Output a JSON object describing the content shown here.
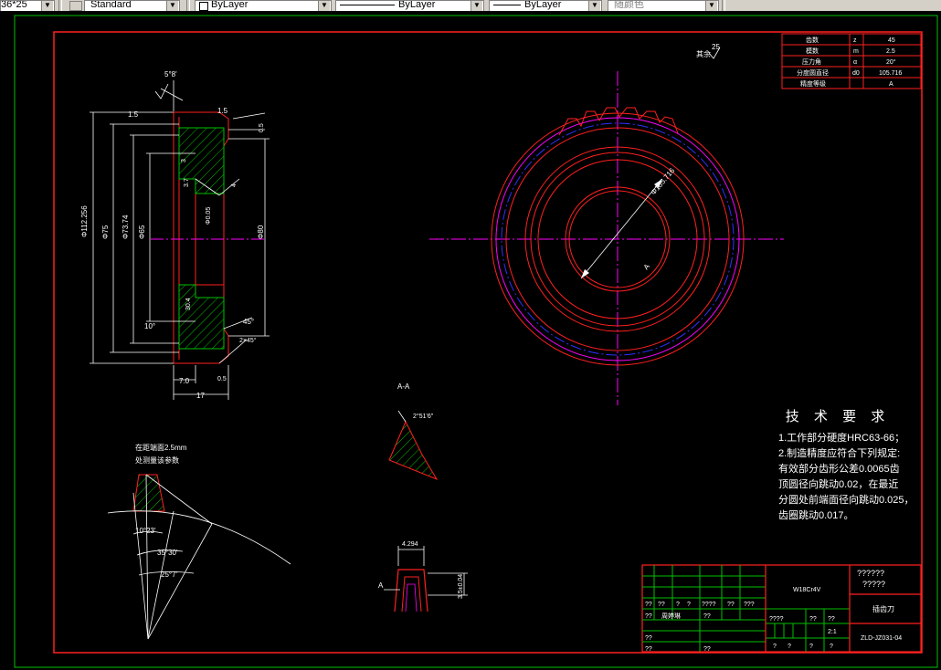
{
  "toolbar": {
    "scale_value": "36*25",
    "text_style": "Standard",
    "layer": "ByLayer",
    "linetype": "ByLayer",
    "lineweight": "ByLayer",
    "color": "随颜色"
  },
  "colors": {
    "border_red": "#ff2020",
    "frame_green": "#00c000",
    "center_magenta": "#ff00ff",
    "pitch_blue": "#3030ff",
    "hatch_green": "#00c000",
    "text_white": "#ffffff"
  },
  "param_table": {
    "rows": [
      {
        "name": "齿数",
        "sym": "z",
        "value": "45"
      },
      {
        "name": "模数",
        "sym": "m",
        "value": "2.5"
      },
      {
        "name": "压力角",
        "sym": "α",
        "value": "20°"
      },
      {
        "name": "分度圆直径",
        "sym": "d0",
        "value": "105.716"
      },
      {
        "name": "精度等级",
        "sym": "",
        "value": "A"
      }
    ]
  },
  "roughness_note": "其余",
  "roughness_value": "25",
  "section_label": "A-A",
  "section_angle": "2°51'6\"",
  "profile_note_1": "在距端面2.5mm",
  "profile_note_2": "处测量该参数",
  "profile_angles": {
    "a": "10°23'",
    "b": "35°30'",
    "c": "25°7'"
  },
  "tooth_dims": {
    "top_width": "4.294",
    "side": "3.5±0.04",
    "mark": "A"
  },
  "front_dims": {
    "top_angle": "5°8'",
    "chamfer_a": "1.5",
    "chamfer_b": "1.5",
    "side_right": "0.5",
    "d_outer": "Φ112.256",
    "d_seat": "Φ75",
    "d_mid": "Φ73.74",
    "d_bore": "Φ65",
    "d_right": "Φ80",
    "width_17": "17",
    "width_7": "7.0",
    "d_3": "3",
    "d_37": "3.7",
    "d_4": "4",
    "r_05": "0.5",
    "d_30": "30.4",
    "angle_10": "10°",
    "angle_45": "45°",
    "angle_25": "2×45°",
    "bore_tol": "Φ0.05"
  },
  "circle_dims": {
    "diameter": "Φ105.716",
    "mark": "A"
  },
  "tech_notes": {
    "title": "技 术 要 求",
    "lines": [
      "1.工作部分硬度HRC63-66；",
      "2.制造精度应符合下列规定:",
      "有效部分齿形公差0.0065齿",
      "顶圆径向跳动0.02，在最近",
      "分圆处前端面径向跳动0.025，",
      "齿圈跳动0.017。"
    ]
  },
  "title_block": {
    "material": "W18Cr4V",
    "title": "插齿刀",
    "code_top": "??????",
    "code_top2": "?????",
    "drawing_no": "ZLD-JZ031-04",
    "scale": "2:1",
    "row_labels": [
      "??",
      "??",
      "?",
      "?",
      "????",
      "??",
      "???"
    ],
    "designer": "周婷琳",
    "q": "??"
  }
}
